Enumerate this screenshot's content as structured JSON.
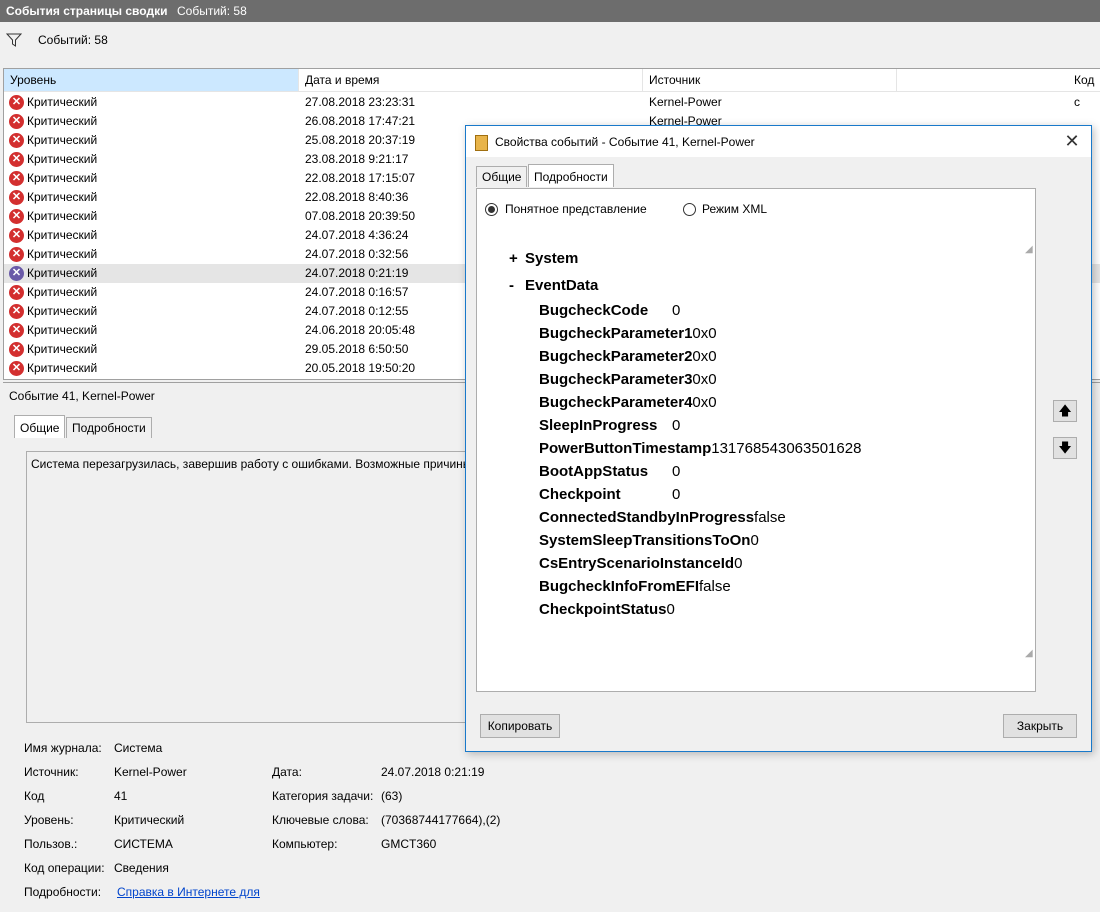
{
  "window": {
    "title": "События страницы сводки",
    "count": "Событий: 58"
  },
  "filter": {
    "icon": "filter-icon",
    "count": "Событий: 58"
  },
  "columns": [
    "Уровень",
    "Дата и время",
    "Источник",
    "Код с"
  ],
  "events": [
    {
      "level": "Критический",
      "datetime": "27.08.2018 23:23:31",
      "source": "Kernel-Power"
    },
    {
      "level": "Критический",
      "datetime": "26.08.2018 17:47:21",
      "source": "Kernel-Power"
    },
    {
      "level": "Критический",
      "datetime": "25.08.2018 20:37:19",
      "source": ""
    },
    {
      "level": "Критический",
      "datetime": "23.08.2018 9:21:17",
      "source": ""
    },
    {
      "level": "Критический",
      "datetime": "22.08.2018 17:15:07",
      "source": ""
    },
    {
      "level": "Критический",
      "datetime": "22.08.2018 8:40:36",
      "source": ""
    },
    {
      "level": "Критический",
      "datetime": "07.08.2018 20:39:50",
      "source": ""
    },
    {
      "level": "Критический",
      "datetime": "24.07.2018 4:36:24",
      "source": ""
    },
    {
      "level": "Критический",
      "datetime": "24.07.2018 0:32:56",
      "source": ""
    },
    {
      "level": "Критический",
      "datetime": "24.07.2018 0:21:19",
      "source": ""
    },
    {
      "level": "Критический",
      "datetime": "24.07.2018 0:16:57",
      "source": ""
    },
    {
      "level": "Критический",
      "datetime": "24.07.2018 0:12:55",
      "source": ""
    },
    {
      "level": "Критический",
      "datetime": "24.06.2018 20:05:48",
      "source": ""
    },
    {
      "level": "Критический",
      "datetime": "29.05.2018 6:50:50",
      "source": ""
    },
    {
      "level": "Критический",
      "datetime": "20.05.2018 19:50:20",
      "source": ""
    }
  ],
  "detail": {
    "header": "Событие 41, Kernel-Power",
    "tabs": [
      "Общие",
      "Подробности"
    ],
    "description": "Система перезагрузилась, завершив работу с ошибками. Возможные причины",
    "props": {
      "journal_label": "Имя журнала:",
      "journal_value": "Система",
      "source_label": "Источник:",
      "source_value": "Kernel-Power",
      "date_label": "Дата:",
      "date_value": "24.07.2018 0:21:19",
      "code_label": "Код",
      "code_value": "41",
      "category_label": "Категория задачи:",
      "category_value": "(63)",
      "level_label": "Уровень:",
      "level_value": "Критический",
      "keywords_label": "Ключевые слова:",
      "keywords_value": "(70368744177664),(2)",
      "user_label": "Пользов.:",
      "user_value": "СИСТЕМА",
      "computer_label": "Компьютер:",
      "computer_value": "GMCT360",
      "opcode_label": "Код операции:",
      "opcode_value": "Сведения",
      "details_label": "Подробности:",
      "details_link": "Справка в Интернете для"
    }
  },
  "dialog": {
    "title": "Свойства событий - Событие 41, Kernel-Power",
    "tabs": [
      "Общие",
      "Подробности"
    ],
    "radio_friendly": "Понятное представление",
    "radio_xml": "Режим XML",
    "system_sign": "+",
    "system_label": "System",
    "eventdata_sign": "-",
    "eventdata_label": "EventData",
    "fields": [
      {
        "name": "BugcheckCode",
        "value": "0"
      },
      {
        "name": "BugcheckParameter1",
        "value": "0x0"
      },
      {
        "name": "BugcheckParameter2",
        "value": "0x0"
      },
      {
        "name": "BugcheckParameter3",
        "value": "0x0"
      },
      {
        "name": "BugcheckParameter4",
        "value": "0x0"
      },
      {
        "name": "SleepInProgress",
        "value": "0"
      },
      {
        "name": "PowerButtonTimestamp",
        "value": "131768543063501628"
      },
      {
        "name": "BootAppStatus",
        "value": "0"
      },
      {
        "name": "Checkpoint",
        "value": "0"
      },
      {
        "name": "ConnectedStandbyInProgress",
        "value": "false"
      },
      {
        "name": "SystemSleepTransitionsToOn",
        "value": "0"
      },
      {
        "name": "CsEntryScenarioInstanceId",
        "value": "0"
      },
      {
        "name": "BugcheckInfoFromEFI",
        "value": "false"
      },
      {
        "name": "CheckpointStatus",
        "value": "0"
      }
    ],
    "copy_label": "Копировать",
    "close_label": "Закрыть",
    "close_icon": "close-icon",
    "up_icon": "arrow-up-icon",
    "down_icon": "arrow-down-icon"
  }
}
